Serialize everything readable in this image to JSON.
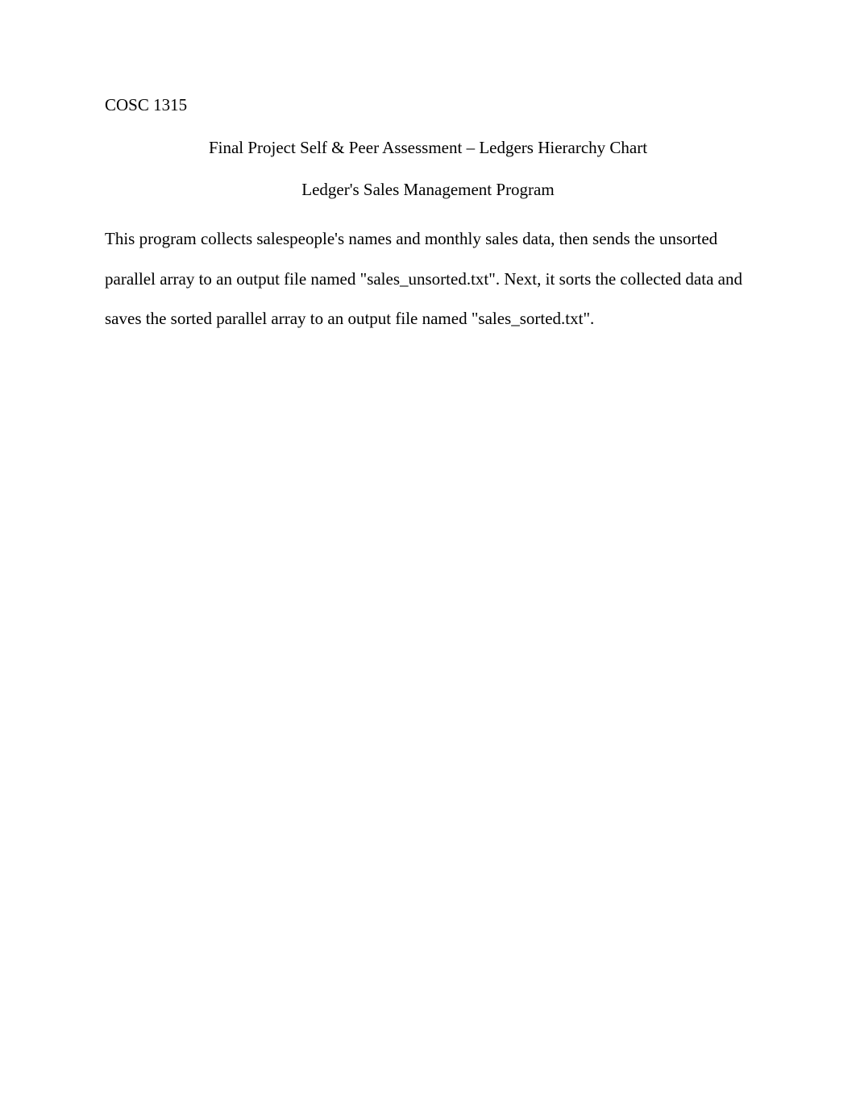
{
  "course_code": "COSC 1315",
  "title": "Final Project Self & Peer Assessment – Ledgers Hierarchy Chart",
  "subtitle": "Ledger's Sales Management Program",
  "body": "This program collects salespeople's names and monthly sales data, then sends the unsorted parallel array to an output  file named  \"sales_unsorted.txt\". Next, it sorts the collected data and saves the sorted parallel array to an  output file named \"sales_sorted.txt\"."
}
